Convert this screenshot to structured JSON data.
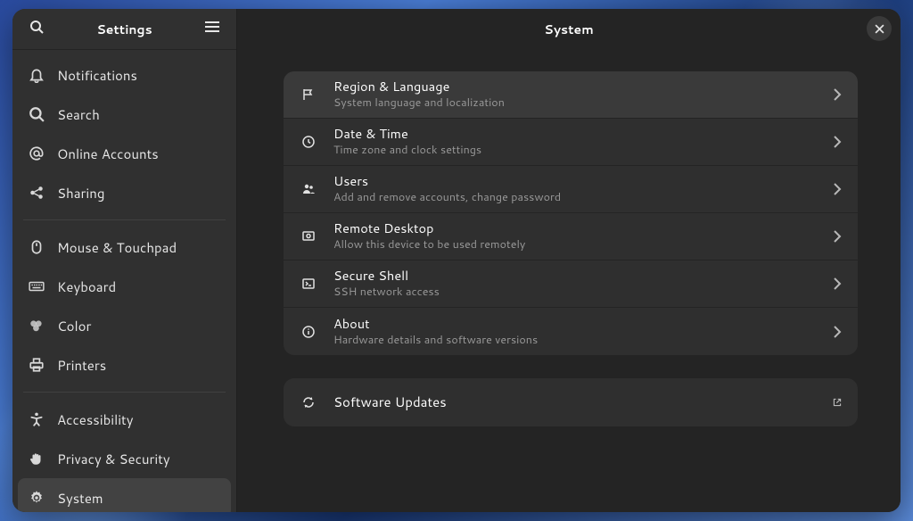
{
  "sidebar": {
    "title": "Settings",
    "items": [
      {
        "label": "Notifications"
      },
      {
        "label": "Search"
      },
      {
        "label": "Online Accounts"
      },
      {
        "label": "Sharing"
      },
      {
        "label": "Mouse & Touchpad"
      },
      {
        "label": "Keyboard"
      },
      {
        "label": "Color"
      },
      {
        "label": "Printers"
      },
      {
        "label": "Accessibility"
      },
      {
        "label": "Privacy & Security"
      },
      {
        "label": "System"
      }
    ]
  },
  "main": {
    "title": "System",
    "rows": [
      {
        "title": "Region & Language",
        "sub": "System language and localization"
      },
      {
        "title": "Date & Time",
        "sub": "Time zone and clock settings"
      },
      {
        "title": "Users",
        "sub": "Add and remove accounts, change password"
      },
      {
        "title": "Remote Desktop",
        "sub": "Allow this device to be used remotely"
      },
      {
        "title": "Secure Shell",
        "sub": "SSH network access"
      },
      {
        "title": "About",
        "sub": "Hardware details and software versions"
      }
    ],
    "updates_label": "Software Updates"
  }
}
